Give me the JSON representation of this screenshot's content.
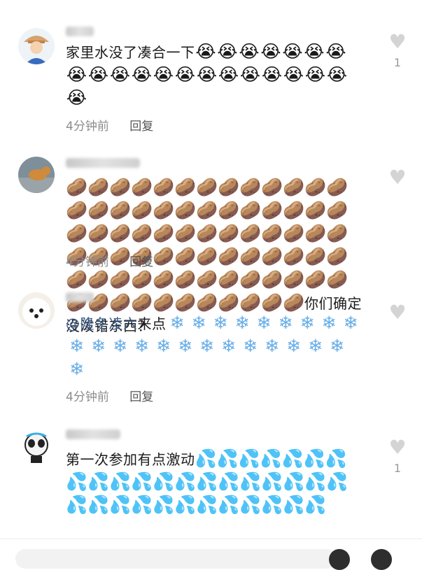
{
  "comments": [
    {
      "text": "家里水没了凑合一下",
      "emoji": "😭😭😭😭😭😭😭😭😭😭😭😭😭😭😭😭😭😭😭😭😭",
      "time": "4分钟前",
      "reply": "回复",
      "likes": "1",
      "avatar_icon": "cartoon-character-avatar"
    },
    {
      "emoji": "🥔🥔🥔🥔🥔🥔🥔🥔🥔🥔🥔🥔🥔🥔🥔🥔🥔🥔🥔🥔🥔🥔🥔🥔🥔🥔🥔🥔🥔🥔🥔🥔🥔🥔🥔🥔🥔🥔🥔🥔🥔🥔🥔🥔🥔🥔🥔🥔🥔🥔🥔🥔🥔🥔🥔🥔🥔🥔🥔🥔🥔🥔🥔🥔🥔🥔🥔🥔🥔🥔🥔🥔🥔🥔🥔🥔",
      "text": "你们确定没泼错东西？",
      "time": "4分钟前",
      "reply": "回复",
      "likes": "",
      "avatar_icon": "dog-photo-avatar"
    },
    {
      "mention": "@隆冬凌六",
      "text": "来点",
      "emoji": "❄❄❄❄❄❄❄❄❄❄❄❄❄❄❄❄❄❄❄❄❄❄❄",
      "time": "4分钟前",
      "reply": "回复",
      "likes": "",
      "avatar_icon": "white-dog-avatar"
    },
    {
      "text": "第一次参加有点激动",
      "emoji": "💦💦💦💦💦💦💦💦💦💦💦💦💦💦💦💦💦💦💦💦💦💦💦💦💦💦💦💦💦💦💦💦",
      "likes": "1",
      "avatar_icon": "panda-mascot-avatar"
    }
  ],
  "icons": {
    "like": "heart-icon"
  },
  "colors": {
    "mention": "#3d5f8c",
    "meta": "#8c8c8c",
    "heart": "#d4d4d4"
  }
}
